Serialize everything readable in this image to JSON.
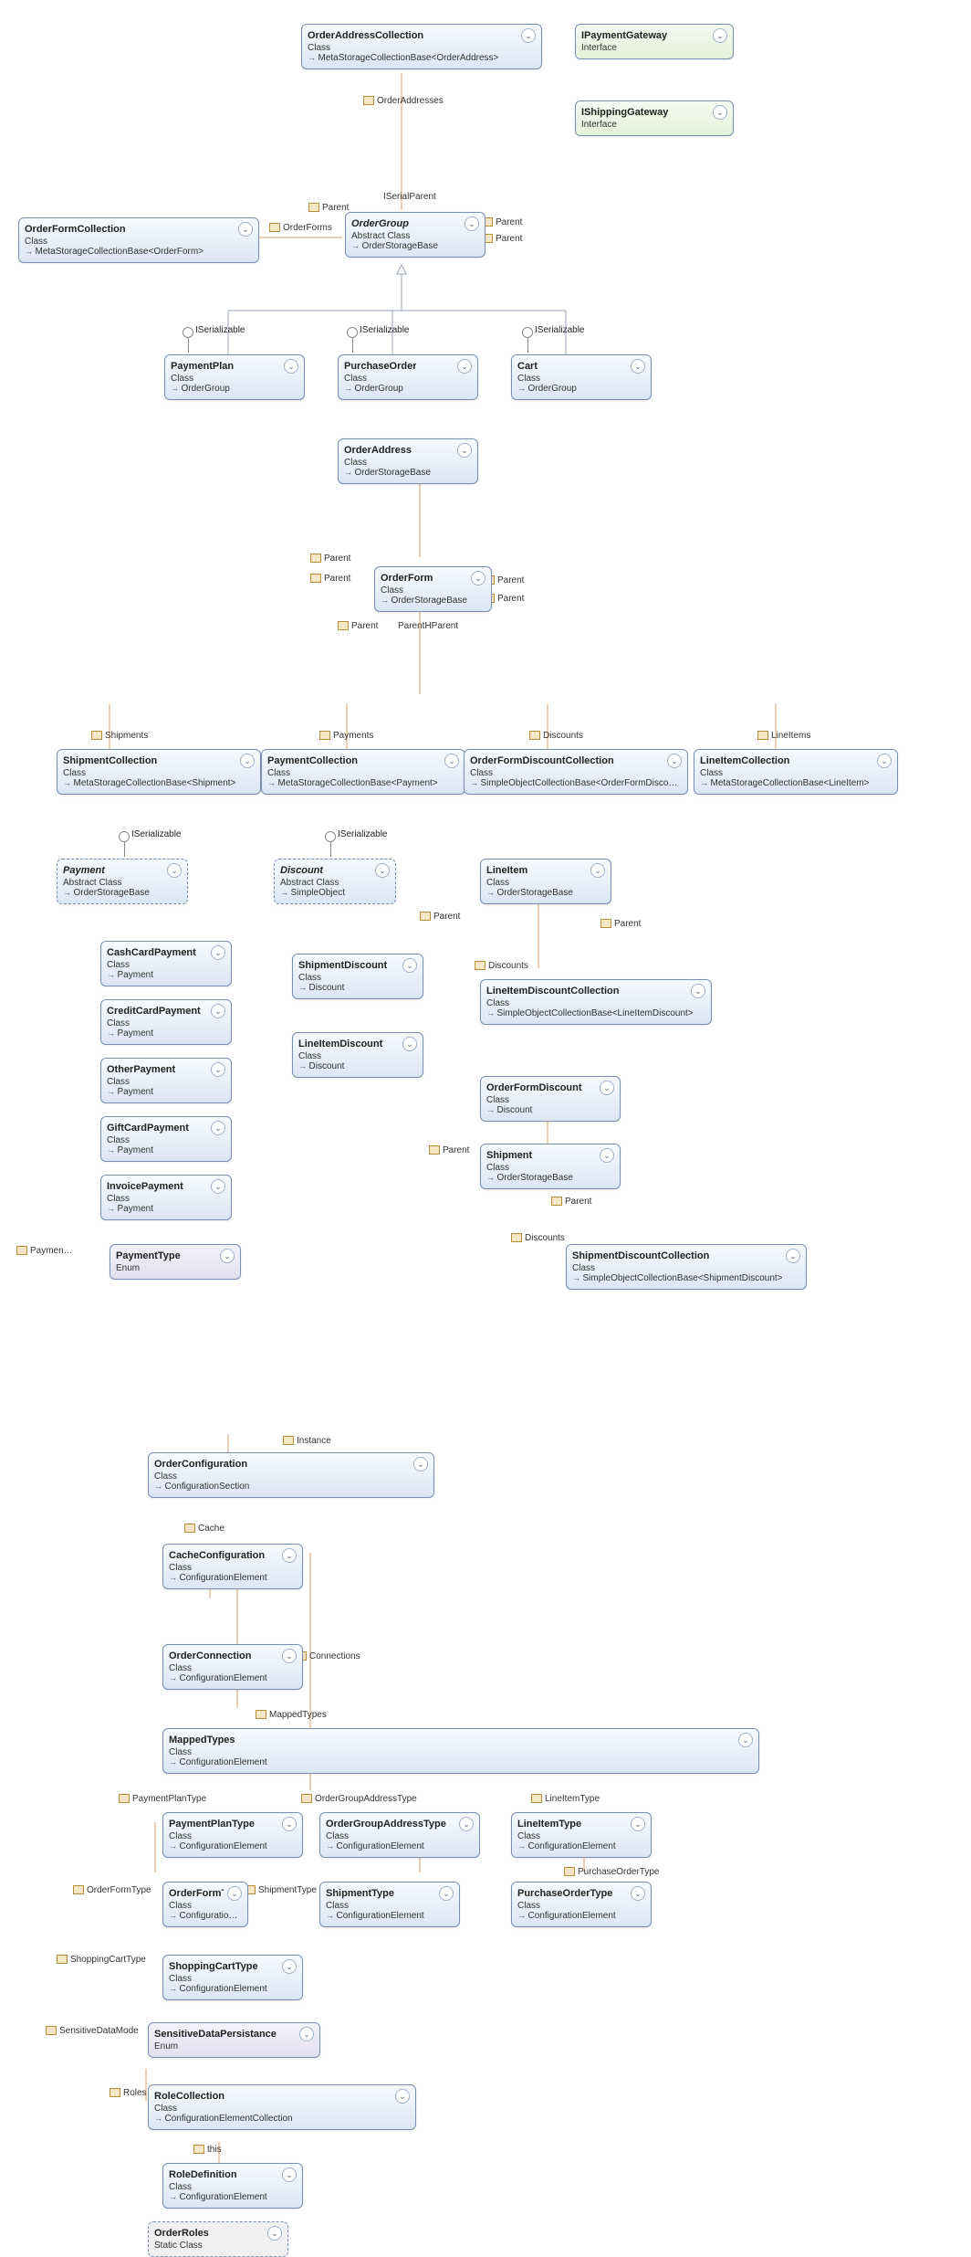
{
  "interfaces": {
    "IPaymentGateway": {
      "name": "IPaymentGateway",
      "stereotype": "Interface"
    },
    "IShippingGateway": {
      "name": "IShippingGateway",
      "stereotype": "Interface"
    }
  },
  "lollipops": {
    "ISerializable": "ISerializable"
  },
  "labels": {
    "OrderAddresses": "OrderAddresses",
    "ISerialParent": "ISerialParent",
    "Parent": "Parent",
    "OrderForms": "OrderForms",
    "Shipments": "Shipments",
    "Payments": "Payments",
    "Discounts": "Discounts",
    "LineItems": "LineItems",
    "ParentHParent": "ParentHParent",
    "Paymen": "Paymen…",
    "Instance": "Instance",
    "Cache": "Cache",
    "Connections": "Connections",
    "MappedTypes": "MappedTypes",
    "PaymentPlanType": "PaymentPlanType",
    "OrderGroupAddressType": "OrderGroupAddressType",
    "LineItemType": "LineItemType",
    "OrderFormType": "OrderFormType",
    "ShipmentType": "ShipmentType",
    "PurchaseOrderType": "PurchaseOrderType",
    "ShoppingCartType": "ShoppingCartType",
    "SensitiveDataMode": "SensitiveDataMode",
    "Roles": "Roles",
    "this": "this"
  },
  "classes": {
    "OrderAddressCollection": {
      "name": "OrderAddressCollection",
      "stereotype": "Class",
      "base": "MetaStorageCollectionBase<OrderAddress>"
    },
    "OrderGroup": {
      "name": "OrderGroup",
      "stereotype": "Abstract Class",
      "base": "OrderStorageBase"
    },
    "OrderFormCollection": {
      "name": "OrderFormCollection",
      "stereotype": "Class",
      "base": "MetaStorageCollectionBase<OrderForm>"
    },
    "PaymentPlan": {
      "name": "PaymentPlan",
      "stereotype": "Class",
      "base": "OrderGroup"
    },
    "PurchaseOrder": {
      "name": "PurchaseOrder",
      "stereotype": "Class",
      "base": "OrderGroup"
    },
    "Cart": {
      "name": "Cart",
      "stereotype": "Class",
      "base": "OrderGroup"
    },
    "OrderAddress": {
      "name": "OrderAddress",
      "stereotype": "Class",
      "base": "OrderStorageBase"
    },
    "OrderForm": {
      "name": "OrderForm",
      "stereotype": "Class",
      "base": "OrderStorageBase"
    },
    "ShipmentCollection": {
      "name": "ShipmentCollection",
      "stereotype": "Class",
      "base": "MetaStorageCollectionBase<Shipment>"
    },
    "PaymentCollection": {
      "name": "PaymentCollection",
      "stereotype": "Class",
      "base": "MetaStorageCollectionBase<Payment>"
    },
    "OrderFormDiscountCollection": {
      "name": "OrderFormDiscountCollection",
      "stereotype": "Class",
      "base": "SimpleObjectCollectionBase<OrderFormDiscount>"
    },
    "LineItemCollection": {
      "name": "LineItemCollection",
      "stereotype": "Class",
      "base": "MetaStorageCollectionBase<LineItem>"
    },
    "Payment": {
      "name": "Payment",
      "stereotype": "Abstract Class",
      "base": "OrderStorageBase"
    },
    "Discount": {
      "name": "Discount",
      "stereotype": "Abstract Class",
      "base": "SimpleObject"
    },
    "LineItem": {
      "name": "LineItem",
      "stereotype": "Class",
      "base": "OrderStorageBase"
    },
    "CashCardPayment": {
      "name": "CashCardPayment",
      "stereotype": "Class",
      "base": "Payment"
    },
    "CreditCardPayment": {
      "name": "CreditCardPayment",
      "stereotype": "Class",
      "base": "Payment"
    },
    "OtherPayment": {
      "name": "OtherPayment",
      "stereotype": "Class",
      "base": "Payment"
    },
    "GiftCardPayment": {
      "name": "GiftCardPayment",
      "stereotype": "Class",
      "base": "Payment"
    },
    "InvoicePayment": {
      "name": "InvoicePayment",
      "stereotype": "Class",
      "base": "Payment"
    },
    "ShipmentDiscount": {
      "name": "ShipmentDiscount",
      "stereotype": "Class",
      "base": "Discount"
    },
    "LineItemDiscount": {
      "name": "LineItemDiscount",
      "stereotype": "Class",
      "base": "Discount"
    },
    "LineItemDiscountCollection": {
      "name": "LineItemDiscountCollection",
      "stereotype": "Class",
      "base": "SimpleObjectCollectionBase<LineItemDiscount>"
    },
    "OrderFormDiscount": {
      "name": "OrderFormDiscount",
      "stereotype": "Class",
      "base": "Discount"
    },
    "Shipment": {
      "name": "Shipment",
      "stereotype": "Class",
      "base": "OrderStorageBase"
    },
    "ShipmentDiscountCollection": {
      "name": "ShipmentDiscountCollection",
      "stereotype": "Class",
      "base": "SimpleObjectCollectionBase<ShipmentDiscount>"
    },
    "PaymentType": {
      "name": "PaymentType",
      "stereotype": "Enum"
    },
    "OrderConfiguration": {
      "name": "OrderConfiguration",
      "stereotype": "Class",
      "base": "ConfigurationSection"
    },
    "CacheConfiguration": {
      "name": "CacheConfiguration",
      "stereotype": "Class",
      "base": "ConfigurationElement"
    },
    "OrderConnection": {
      "name": "OrderConnection",
      "stereotype": "Class",
      "base": "ConfigurationElement"
    },
    "MappedTypes": {
      "name": "MappedTypes",
      "stereotype": "Class",
      "base": "ConfigurationElement"
    },
    "PaymentPlanType": {
      "name": "PaymentPlanType",
      "stereotype": "Class",
      "base": "ConfigurationElement"
    },
    "OrderGroupAddressType": {
      "name": "OrderGroupAddressType",
      "stereotype": "Class",
      "base": "ConfigurationElement"
    },
    "LineItemType": {
      "name": "LineItemType",
      "stereotype": "Class",
      "base": "ConfigurationElement"
    },
    "OrderFormType": {
      "name": "OrderFormTy…",
      "stereotype": "Class",
      "base": "ConfigurationElement"
    },
    "ShipmentType": {
      "name": "ShipmentType",
      "stereotype": "Class",
      "base": "ConfigurationElement"
    },
    "PurchaseOrderType": {
      "name": "PurchaseOrderType",
      "stereotype": "Class",
      "base": "ConfigurationElement"
    },
    "ShoppingCartType": {
      "name": "ShoppingCartType",
      "stereotype": "Class",
      "base": "ConfigurationElement"
    },
    "SensitiveDataPersistance": {
      "name": "SensitiveDataPersistance",
      "stereotype": "Enum"
    },
    "RoleCollection": {
      "name": "RoleCollection",
      "stereotype": "Class",
      "base": "ConfigurationElementCollection"
    },
    "RoleDefinition": {
      "name": "RoleDefinition",
      "stereotype": "Class",
      "base": "ConfigurationElement"
    },
    "OrderRoles": {
      "name": "OrderRoles",
      "stereotype": "Static Class"
    }
  },
  "chart_data": {
    "type": "uml-class-diagram",
    "nodes": [
      {
        "id": "IPaymentGateway",
        "kind": "interface"
      },
      {
        "id": "IShippingGateway",
        "kind": "interface"
      },
      {
        "id": "OrderAddressCollection",
        "kind": "class",
        "base": "MetaStorageCollectionBase<OrderAddress>"
      },
      {
        "id": "OrderGroup",
        "kind": "abstract-class",
        "base": "OrderStorageBase",
        "implements": [
          "ISerializable"
        ]
      },
      {
        "id": "OrderFormCollection",
        "kind": "class",
        "base": "MetaStorageCollectionBase<OrderForm>"
      },
      {
        "id": "PaymentPlan",
        "kind": "class",
        "base": "OrderGroup",
        "implements": [
          "ISerializable"
        ]
      },
      {
        "id": "PurchaseOrder",
        "kind": "class",
        "base": "OrderGroup",
        "implements": [
          "ISerializable"
        ]
      },
      {
        "id": "Cart",
        "kind": "class",
        "base": "OrderGroup",
        "implements": [
          "ISerializable"
        ]
      },
      {
        "id": "OrderAddress",
        "kind": "class",
        "base": "OrderStorageBase"
      },
      {
        "id": "OrderForm",
        "kind": "class",
        "base": "OrderStorageBase"
      },
      {
        "id": "ShipmentCollection",
        "kind": "class",
        "base": "MetaStorageCollectionBase<Shipment>"
      },
      {
        "id": "PaymentCollection",
        "kind": "class",
        "base": "MetaStorageCollectionBase<Payment>"
      },
      {
        "id": "OrderFormDiscountCollection",
        "kind": "class",
        "base": "SimpleObjectCollectionBase<OrderFormDiscount>"
      },
      {
        "id": "LineItemCollection",
        "kind": "class",
        "base": "MetaStorageCollectionBase<LineItem>"
      },
      {
        "id": "Payment",
        "kind": "abstract-class",
        "base": "OrderStorageBase",
        "implements": [
          "ISerializable"
        ]
      },
      {
        "id": "Discount",
        "kind": "abstract-class",
        "base": "SimpleObject",
        "implements": [
          "ISerializable"
        ]
      },
      {
        "id": "LineItem",
        "kind": "class",
        "base": "OrderStorageBase"
      },
      {
        "id": "CashCardPayment",
        "kind": "class",
        "base": "Payment"
      },
      {
        "id": "CreditCardPayment",
        "kind": "class",
        "base": "Payment"
      },
      {
        "id": "OtherPayment",
        "kind": "class",
        "base": "Payment"
      },
      {
        "id": "GiftCardPayment",
        "kind": "class",
        "base": "Payment"
      },
      {
        "id": "InvoicePayment",
        "kind": "class",
        "base": "Payment"
      },
      {
        "id": "ShipmentDiscount",
        "kind": "class",
        "base": "Discount"
      },
      {
        "id": "LineItemDiscount",
        "kind": "class",
        "base": "Discount"
      },
      {
        "id": "LineItemDiscountCollection",
        "kind": "class",
        "base": "SimpleObjectCollectionBase<LineItemDiscount>"
      },
      {
        "id": "OrderFormDiscount",
        "kind": "class",
        "base": "Discount"
      },
      {
        "id": "Shipment",
        "kind": "class",
        "base": "OrderStorageBase"
      },
      {
        "id": "ShipmentDiscountCollection",
        "kind": "class",
        "base": "SimpleObjectCollectionBase<ShipmentDiscount>"
      },
      {
        "id": "PaymentType",
        "kind": "enum"
      },
      {
        "id": "OrderConfiguration",
        "kind": "class",
        "base": "ConfigurationSection"
      },
      {
        "id": "CacheConfiguration",
        "kind": "class",
        "base": "ConfigurationElement"
      },
      {
        "id": "OrderConnection",
        "kind": "class",
        "base": "ConfigurationElement"
      },
      {
        "id": "MappedTypes",
        "kind": "class",
        "base": "ConfigurationElement"
      },
      {
        "id": "PaymentPlanType",
        "kind": "class",
        "base": "ConfigurationElement"
      },
      {
        "id": "OrderGroupAddressType",
        "kind": "class",
        "base": "ConfigurationElement"
      },
      {
        "id": "LineItemType",
        "kind": "class",
        "base": "ConfigurationElement"
      },
      {
        "id": "OrderFormType",
        "kind": "class",
        "base": "ConfigurationElement"
      },
      {
        "id": "ShipmentType",
        "kind": "class",
        "base": "ConfigurationElement"
      },
      {
        "id": "PurchaseOrderType",
        "kind": "class",
        "base": "ConfigurationElement"
      },
      {
        "id": "ShoppingCartType",
        "kind": "class",
        "base": "ConfigurationElement"
      },
      {
        "id": "SensitiveDataPersistance",
        "kind": "enum"
      },
      {
        "id": "RoleCollection",
        "kind": "class",
        "base": "ConfigurationElementCollection"
      },
      {
        "id": "RoleDefinition",
        "kind": "class",
        "base": "ConfigurationElement"
      },
      {
        "id": "OrderRoles",
        "kind": "static-class"
      }
    ],
    "associations": [
      {
        "from": "OrderGroup",
        "to": "OrderAddressCollection",
        "label": "OrderAddresses"
      },
      {
        "from": "OrderAddressCollection",
        "to": "OrderGroup",
        "label": "Parent"
      },
      {
        "from": "OrderGroup",
        "to": "OrderFormCollection",
        "label": "OrderForms"
      },
      {
        "from": "OrderFormCollection",
        "to": "OrderGroup",
        "label": "Parent"
      },
      {
        "from": "OrderAddress",
        "to": "OrderGroup",
        "label": "Parent"
      },
      {
        "from": "OrderForm",
        "to": "OrderGroup",
        "label": "Parent"
      },
      {
        "from": "OrderForm",
        "to": "ShipmentCollection",
        "label": "Shipments"
      },
      {
        "from": "OrderForm",
        "to": "PaymentCollection",
        "label": "Payments"
      },
      {
        "from": "OrderForm",
        "to": "OrderFormDiscountCollection",
        "label": "Discounts"
      },
      {
        "from": "OrderForm",
        "to": "LineItemCollection",
        "label": "LineItems"
      },
      {
        "from": "ShipmentCollection",
        "to": "OrderForm",
        "label": "Parent"
      },
      {
        "from": "PaymentCollection",
        "to": "OrderForm",
        "label": "Parent"
      },
      {
        "from": "OrderFormDiscountCollection",
        "to": "OrderForm",
        "label": "Parent"
      },
      {
        "from": "LineItemCollection",
        "to": "OrderForm",
        "label": "Parent"
      },
      {
        "from": "Payment",
        "to": "OrderForm",
        "label": "Parent"
      },
      {
        "from": "LineItem",
        "to": "OrderForm",
        "label": "Parent"
      },
      {
        "from": "OrderFormDiscount",
        "to": "OrderForm",
        "label": "Parent"
      },
      {
        "from": "Shipment",
        "to": "OrderForm",
        "label": "Parent"
      },
      {
        "from": "LineItem",
        "to": "LineItemDiscountCollection",
        "label": "Discounts"
      },
      {
        "from": "LineItemDiscountCollection",
        "to": "LineItem",
        "label": "Parent"
      },
      {
        "from": "Shipment",
        "to": "ShipmentDiscountCollection",
        "label": "Discounts"
      },
      {
        "from": "ShipmentDiscountCollection",
        "to": "Shipment",
        "label": "Parent"
      },
      {
        "from": "Payment",
        "to": "PaymentType",
        "label": "Paymen…"
      },
      {
        "from": "OrderConfiguration",
        "to": "OrderConfiguration",
        "label": "Instance"
      },
      {
        "from": "OrderConfiguration",
        "to": "CacheConfiguration",
        "label": "Cache"
      },
      {
        "from": "OrderConfiguration",
        "to": "OrderConnection",
        "label": "Connections"
      },
      {
        "from": "OrderConfiguration",
        "to": "MappedTypes",
        "label": "MappedTypes"
      },
      {
        "from": "MappedTypes",
        "to": "PaymentPlanType",
        "label": "PaymentPlanType"
      },
      {
        "from": "MappedTypes",
        "to": "OrderGroupAddressType",
        "label": "OrderGroupAddressType"
      },
      {
        "from": "MappedTypes",
        "to": "LineItemType",
        "label": "LineItemType"
      },
      {
        "from": "MappedTypes",
        "to": "OrderFormType",
        "label": "OrderFormType"
      },
      {
        "from": "MappedTypes",
        "to": "ShipmentType",
        "label": "ShipmentType"
      },
      {
        "from": "MappedTypes",
        "to": "PurchaseOrderType",
        "label": "PurchaseOrderType"
      },
      {
        "from": "MappedTypes",
        "to": "ShoppingCartType",
        "label": "ShoppingCartType"
      },
      {
        "from": "OrderConfiguration",
        "to": "SensitiveDataPersistance",
        "label": "SensitiveDataMode"
      },
      {
        "from": "OrderConfiguration",
        "to": "RoleCollection",
        "label": "Roles"
      },
      {
        "from": "RoleCollection",
        "to": "RoleDefinition",
        "label": "this"
      }
    ],
    "inheritance": [
      {
        "child": "PaymentPlan",
        "parent": "OrderGroup"
      },
      {
        "child": "PurchaseOrder",
        "parent": "OrderGroup"
      },
      {
        "child": "Cart",
        "parent": "OrderGroup"
      },
      {
        "child": "CashCardPayment",
        "parent": "Payment"
      },
      {
        "child": "CreditCardPayment",
        "parent": "Payment"
      },
      {
        "child": "OtherPayment",
        "parent": "Payment"
      },
      {
        "child": "GiftCardPayment",
        "parent": "Payment"
      },
      {
        "child": "InvoicePayment",
        "parent": "Payment"
      },
      {
        "child": "ShipmentDiscount",
        "parent": "Discount"
      },
      {
        "child": "LineItemDiscount",
        "parent": "Discount"
      },
      {
        "child": "OrderFormDiscount",
        "parent": "Discount"
      }
    ]
  }
}
